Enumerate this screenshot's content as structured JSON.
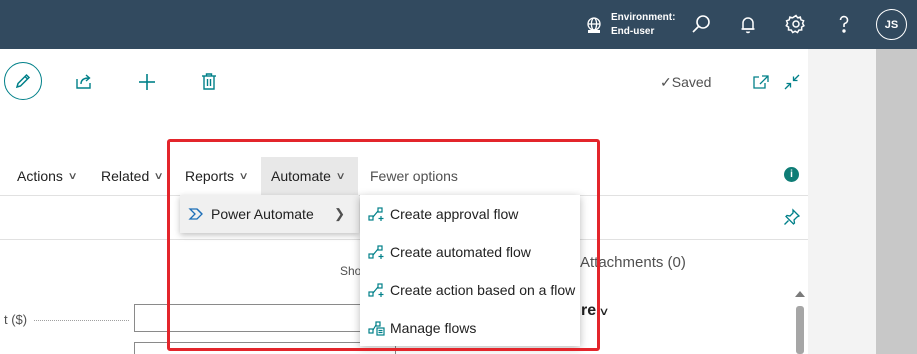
{
  "topbar": {
    "environment_label": "Environment:",
    "environment_value": "End-user",
    "avatar_initials": "JS"
  },
  "command_bar": {
    "saved_label": "Saved"
  },
  "action_menu": {
    "items": [
      {
        "label": "Actions"
      },
      {
        "label": "Related"
      },
      {
        "label": "Reports"
      },
      {
        "label": "Automate"
      }
    ],
    "fewer_options": "Fewer options"
  },
  "submenu": {
    "power_automate": "Power Automate"
  },
  "flyout": {
    "items": [
      {
        "label": "Create approval flow"
      },
      {
        "label": "Create automated flow"
      },
      {
        "label": "Create action based on a flow"
      },
      {
        "label": "Manage flows"
      }
    ]
  },
  "background": {
    "show_text": "Sho",
    "attachments": "Attachments (0)",
    "field_label_fragment": "t ($)",
    "heading_fragment": "re"
  },
  "colors": {
    "topbar": "#324a5f",
    "accent": "#008089",
    "highlight_box": "#e3252b"
  },
  "icons": [
    "environment-icon",
    "search-icon",
    "bell-icon",
    "gear-icon",
    "help-icon",
    "edit-icon",
    "share-icon",
    "plus-icon",
    "delete-icon",
    "open-new-window-icon",
    "collapse-icon",
    "info-icon",
    "pin-icon",
    "power-automate-icon",
    "flow-icon"
  ]
}
